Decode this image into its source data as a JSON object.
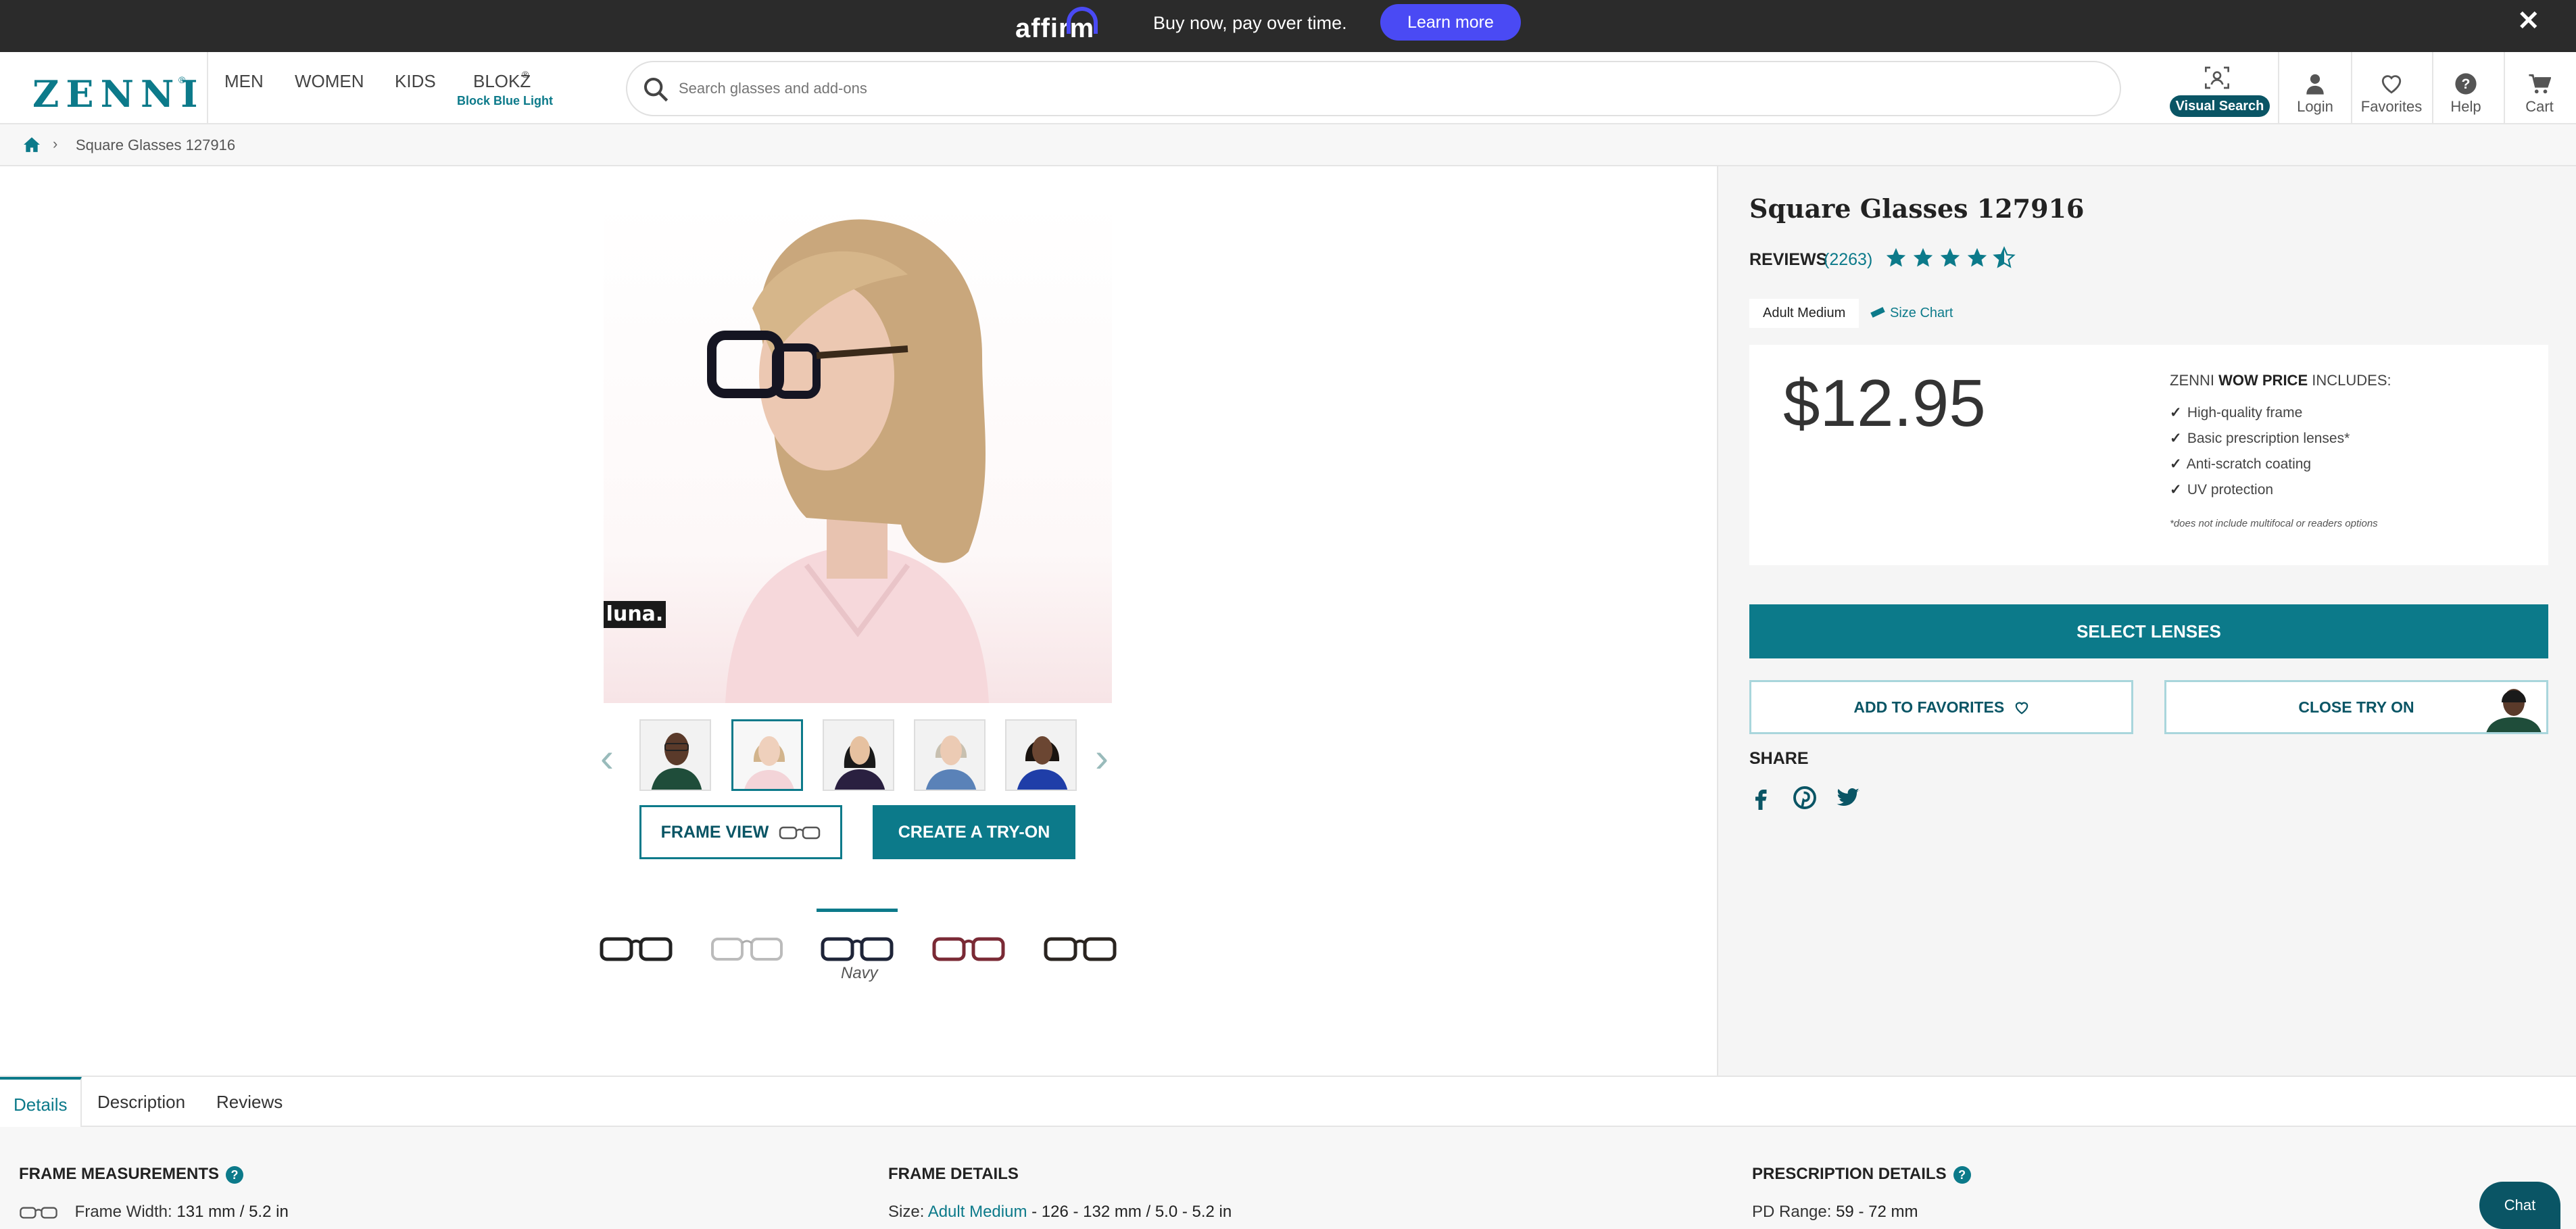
{
  "promo": {
    "brand": "affirm",
    "text": "Buy now, pay over time.",
    "cta": "Learn more"
  },
  "header": {
    "logo": "ZENNI",
    "nav": [
      {
        "label": "MEN"
      },
      {
        "label": "WOMEN"
      },
      {
        "label": "KIDS"
      },
      {
        "label": "BLOKZ",
        "sub": "Block Blue Light"
      }
    ],
    "search_placeholder": "Search glasses and add-ons",
    "visual_search": "Visual Search",
    "actions": [
      {
        "label": "Login",
        "icon": "user-icon"
      },
      {
        "label": "Favorites",
        "icon": "heart-icon"
      },
      {
        "label": "Help",
        "icon": "help-icon"
      },
      {
        "label": "Cart",
        "icon": "cart-icon"
      }
    ]
  },
  "breadcrumb": {
    "current": "Square Glasses 127916"
  },
  "gallery": {
    "badge": "luna.",
    "buttons": {
      "frame_view": "FRAME VIEW",
      "create_tryon": "CREATE A TRY-ON"
    },
    "selected_color": "Navy",
    "colors": [
      "black",
      "clear",
      "navy",
      "red",
      "tortoise"
    ]
  },
  "product": {
    "title": "Square Glasses 127916",
    "reviews_label": "REVIEWS",
    "reviews_count": "(2263)",
    "rating": 4.5,
    "size": "Adult Medium",
    "size_chart": "Size Chart",
    "price": "$12.95",
    "wow_prefix": "ZENNI",
    "wow_bold": "WOW PRICE",
    "wow_suffix": "INCLUDES:",
    "includes": [
      "High-quality frame",
      "Basic prescription lenses*",
      "Anti-scratch coating",
      "UV protection"
    ],
    "disclaimer": "*does not include multifocal or readers options",
    "select_lenses": "SELECT LENSES",
    "add_favorites": "ADD TO FAVORITES",
    "close_tryon": "CLOSE TRY ON",
    "share": "SHARE"
  },
  "tabs": [
    "Details",
    "Description",
    "Reviews"
  ],
  "details": {
    "frame_measurements": {
      "title": "FRAME MEASUREMENTS",
      "label": "Frame Width:",
      "value": "131 mm / 5.2 in"
    },
    "frame_details": {
      "title": "FRAME DETAILS",
      "label": "Size:",
      "size": "Adult Medium",
      "value": " -  126 - 132 mm / 5.0 - 5.2 in"
    },
    "prescription_details": {
      "title": "PRESCRIPTION DETAILS",
      "label": "PD Range:",
      "value": "59 - 72 mm"
    }
  },
  "chat": "Chat",
  "colors": {
    "accent": "#0c7a8a",
    "accent_dark": "#0a5565",
    "affirm": "#4a4af4",
    "promo_bg": "#2b2b2b"
  }
}
